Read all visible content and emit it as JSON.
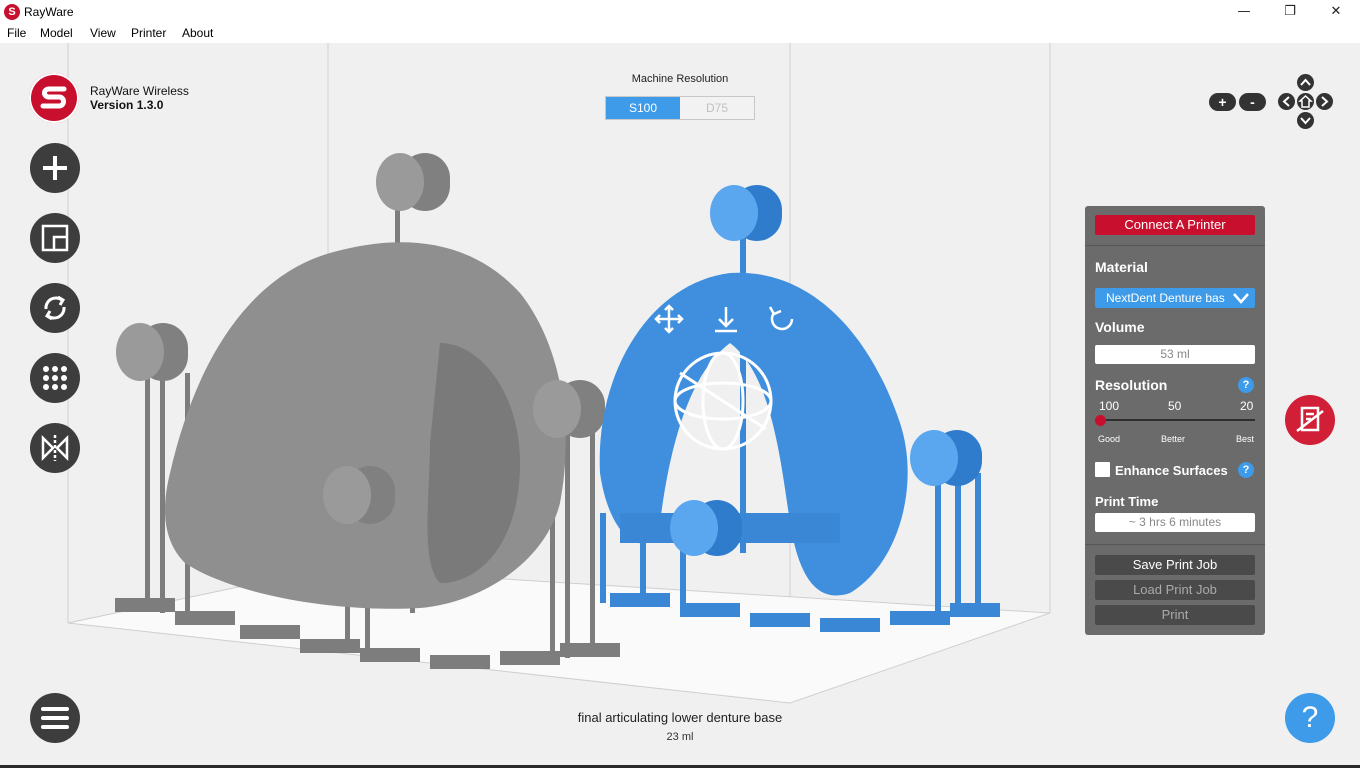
{
  "window": {
    "app_icon_letter": "S",
    "title": "RayWare",
    "minimize": "—",
    "maximize": "❐",
    "close": "✕"
  },
  "menubar": {
    "items": [
      "File",
      "Model",
      "View",
      "Printer",
      "About"
    ]
  },
  "brand": {
    "name": "RayWare Wireless",
    "version": "Version 1.3.0"
  },
  "machine_resolution": {
    "label": "Machine Resolution",
    "options": [
      "S100",
      "D75"
    ],
    "selected": "S100"
  },
  "zoom": {
    "in": "+",
    "out": "-"
  },
  "panel": {
    "connect_label": "Connect A Printer",
    "material_label": "Material",
    "material_value": "NextDent Denture bas",
    "volume_label": "Volume",
    "volume_value": "53 ml",
    "resolution_label": "Resolution",
    "help_glyph": "?",
    "ticks": [
      "100",
      "50",
      "20"
    ],
    "quality": [
      "Good",
      "Better",
      "Best"
    ],
    "resolution_level": 0,
    "enhance_label": "Enhance Surfaces",
    "enhance_checked": false,
    "print_time_label": "Print Time",
    "print_time_value": "~ 3 hrs 6 minutes",
    "save_label": "Save Print Job",
    "load_label": "Load Print Job",
    "print_label": "Print"
  },
  "help_button_label": "?",
  "selected_model": {
    "name": "final articulating lower denture base",
    "volume": "23 ml"
  },
  "colors": {
    "accent_red": "#c8102e",
    "accent_blue": "#3d9be9",
    "panel_gray": "#6b6b6b",
    "model_gray": "#8a8a8a",
    "model_blue": "#3a87d6"
  }
}
